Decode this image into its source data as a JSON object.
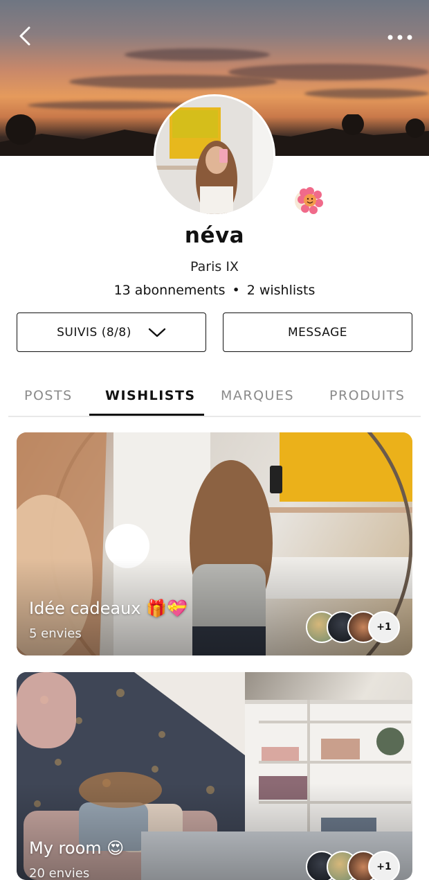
{
  "profile": {
    "name": "néva",
    "location": "Paris IX",
    "following_text": "13 abonnements",
    "wishlists_text": "2 wishlists",
    "separator": "•"
  },
  "actions": {
    "follow_label": "SUIVIS (8/8)",
    "message_label": "MESSAGE"
  },
  "tabs": [
    {
      "label": "POSTS",
      "active": false
    },
    {
      "label": "WISHLISTS",
      "active": true
    },
    {
      "label": "MARQUES",
      "active": false
    },
    {
      "label": "PRODUITS",
      "active": false
    }
  ],
  "wishlists": [
    {
      "title": "Idée cadeaux 🎁💝",
      "subtitle": "5 envies",
      "extra_count": "+1"
    },
    {
      "title": "My room 😍",
      "subtitle": "20 envies",
      "extra_count": "+1"
    }
  ],
  "icons": {
    "back": "chevron-left-icon",
    "more": "more-horizontal-icon",
    "dropdown": "chevron-down-icon",
    "sticker": "flower-sticker-icon"
  },
  "colors": {
    "text": "#111111",
    "muted_tab": "#8a8a8a",
    "border": "#111111"
  }
}
